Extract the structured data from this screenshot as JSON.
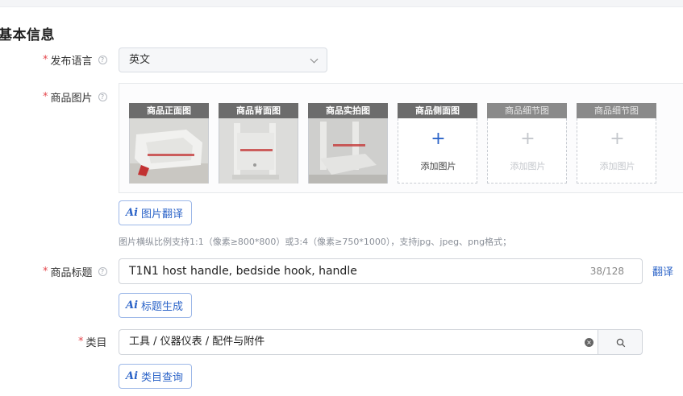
{
  "section": {
    "title": "基本信息"
  },
  "labels": {
    "required_mark": "*",
    "help_mark": "?",
    "language": "发布语言",
    "images": "商品图片",
    "title": "商品标题",
    "category": "类目"
  },
  "language": {
    "selected": "英文"
  },
  "images": {
    "slots": [
      {
        "caption": "商品正面图",
        "state": "filled"
      },
      {
        "caption": "商品背面图",
        "state": "filled"
      },
      {
        "caption": "商品实拍图",
        "state": "filled"
      },
      {
        "caption": "商品侧面图",
        "state": "empty-active",
        "add_label": "添加图片",
        "plus": "+"
      },
      {
        "caption": "商品细节图",
        "state": "empty-disabled",
        "add_label": "添加图片",
        "plus": "+"
      },
      {
        "caption": "商品细节图",
        "state": "empty-disabled",
        "add_label": "添加图片",
        "plus": "+"
      }
    ],
    "translate_button": "图片翻译",
    "hint": "图片横纵比例支持1:1（像素≥800*800）或3:4（像素≥750*1000），支持jpg、jpeg、png格式；"
  },
  "ai": {
    "mark": "Ai"
  },
  "title": {
    "value": "T1N1 host handle, bedside hook, handle",
    "count": "38/128",
    "translate_link": "翻译",
    "generate_button": "标题生成"
  },
  "category": {
    "value": "工具 / 仪器仪表 / 配件与附件",
    "clear_mark": "×",
    "query_button": "类目查询"
  },
  "colors": {
    "accent": "#2c64c8",
    "required": "#e5484d",
    "caption_bg": "#6c6c6c",
    "disabled_text": "#c4c7cc"
  }
}
